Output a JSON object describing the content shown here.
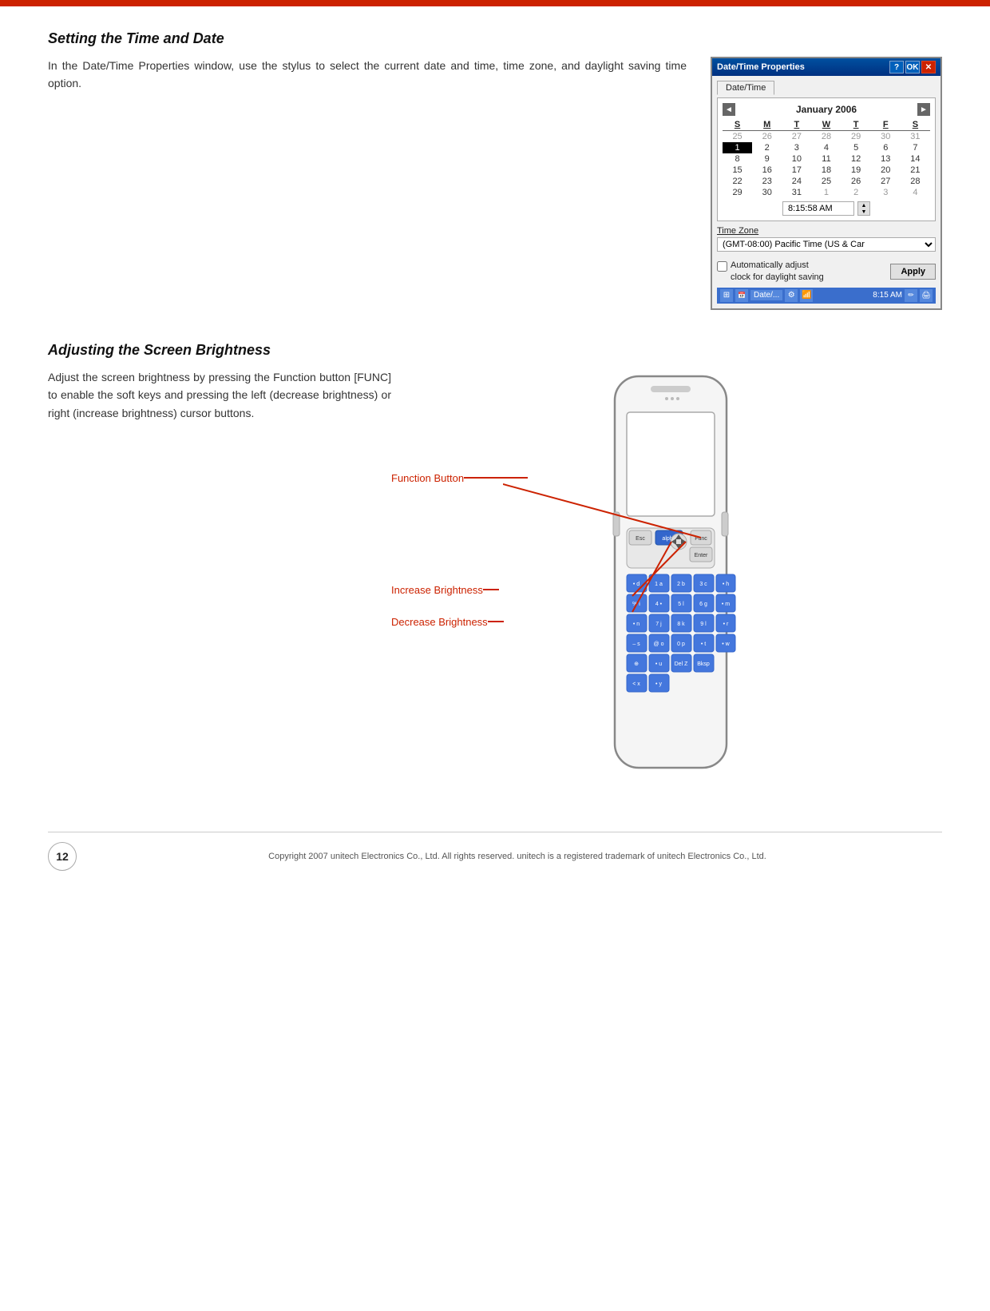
{
  "top_bar_color": "#cc2200",
  "section1": {
    "title": "Setting the Time and Date",
    "text": "In the Date/Time Properties window, use the stylus to select the current date and time, time zone, and daylight saving time option.",
    "window": {
      "title": "Date/Time Properties",
      "tab": "Date/Time",
      "month": "January 2006",
      "days_header": [
        "S",
        "M",
        "T",
        "W",
        "T",
        "F",
        "S"
      ],
      "weeks": [
        [
          "25",
          "26",
          "27",
          "28",
          "29",
          "30",
          "31"
        ],
        [
          "1",
          "2",
          "3",
          "4",
          "5",
          "6",
          "7"
        ],
        [
          "8",
          "9",
          "10",
          "11",
          "12",
          "13",
          "14"
        ],
        [
          "15",
          "16",
          "17",
          "18",
          "19",
          "20",
          "21"
        ],
        [
          "22",
          "23",
          "24",
          "25",
          "26",
          "27",
          "28"
        ],
        [
          "29",
          "30",
          "31",
          "1",
          "2",
          "3",
          "4"
        ]
      ],
      "selected_day": "1",
      "time": "8:15:58 AM",
      "timezone_label": "Time Zone",
      "timezone_value": "(GMT-08:00) Pacific Time (US & Car",
      "dst_text1": "Automatically adjust",
      "dst_text2": "clock for daylight saving",
      "apply_label": "Apply",
      "taskbar_time": "8:15 AM",
      "taskbar_date_label": "Date/..."
    }
  },
  "section2": {
    "title": "Adjusting the Screen Brightness",
    "text": "Adjust the screen brightness by pressing the Function button [FUNC] to enable the soft keys and pressing the left (decrease brightness) or right (increase brightness) cursor buttons.",
    "labels": {
      "function_button": "Function Button",
      "increase_brightness": "Increase Brightness",
      "decrease_brightness": "Decrease Brightness"
    }
  },
  "footer": {
    "page_number": "12",
    "copyright": "Copyright 2007 unitech Electronics Co., Ltd. All rights reserved. unitech is a registered trademark of unitech Electronics Co., Ltd."
  }
}
